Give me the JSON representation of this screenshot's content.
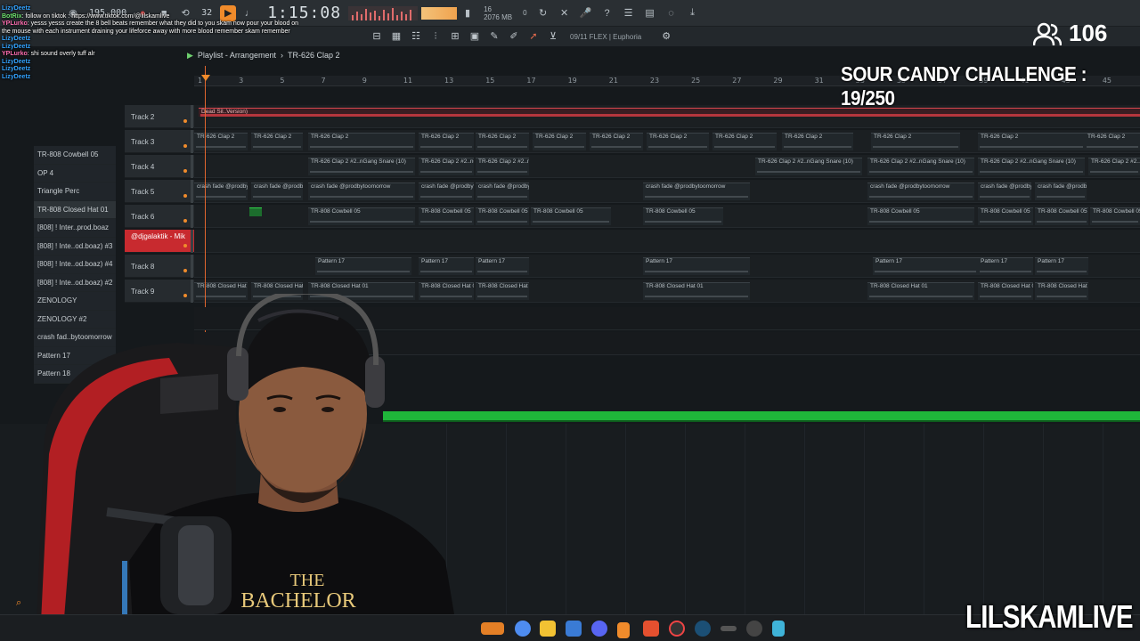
{
  "toolbar": {
    "tempo": "195.000",
    "pattern_num": "32",
    "time": "1:15:08",
    "stats_top": "16",
    "stats_mem": "2076 MB",
    "stats_cpu": "0"
  },
  "toolbar2": {
    "flex_label": "09/11  FLEX | Euphoria"
  },
  "playlist": {
    "title": "Playlist - Arrangement",
    "current_pattern": "TR-626 Clap 2",
    "ruler_bars": [
      "1",
      "3",
      "5",
      "7",
      "9",
      "11",
      "13",
      "15",
      "17",
      "19",
      "21",
      "23",
      "25",
      "27",
      "29",
      "31",
      "33",
      "35",
      "37",
      "39",
      "41",
      "43",
      "45"
    ]
  },
  "tracks": [
    {
      "name": "Track 2",
      "clip_label": "Dead Sil..Version)"
    },
    {
      "name": "Track 3",
      "clip_label": "TR-626 Clap 2"
    },
    {
      "name": "Track 4",
      "clip_label": "TR-626 Clap 2 #2..nGang Snare (10)"
    },
    {
      "name": "Track 5",
      "clip_label": "crash fade @prodbytoomorrow"
    },
    {
      "name": "Track 6",
      "clip_label": "TR-808 Cowbell 05"
    },
    {
      "name": "@djgalaktik - Mik",
      "clip_label": ""
    },
    {
      "name": "Track 8",
      "clip_label": "Pattern 17"
    },
    {
      "name": "Track 9",
      "clip_label": "TR-808 Closed Hat 01"
    }
  ],
  "channels": [
    "TR-808 Cowbell 05",
    "OP 4",
    "Triangle Perc",
    "TR-808 Closed Hat 01",
    "[808] ! Inter..prod.boaz",
    "[808] ! Inte..od.boaz) #3",
    "[808] ! Inte..od.boaz) #4",
    "[808] ! Inte..od.boaz) #2",
    "ZENOLOGY",
    "ZENOLOGY #2",
    "crash fad..bytoomorrow",
    "Pattern 17",
    "Pattern 18"
  ],
  "chat": [
    {
      "user": "LizyDeetz",
      "text": ""
    },
    {
      "user": "BotRix",
      "text": ": follow on tiktok : https://www.tiktok.com/@lilskamlive"
    },
    {
      "user": "YPLurko",
      "text": ": yesss yesss create the 8 bell beats remember what they did to you skam now pour your blood on"
    },
    {
      "user": "",
      "text": "the mouse with each instrument draining your lifeforce away with more blood remember skam remember"
    },
    {
      "user": "LizyDeetz",
      "text": ""
    },
    {
      "user": "LizyDeetz",
      "text": ""
    },
    {
      "user": "YPLurko",
      "text": ": shi sound overly tuff alr"
    },
    {
      "user": "LizyDeetz",
      "text": ""
    },
    {
      "user": "LizyDeetz",
      "text": ""
    },
    {
      "user": "LizyDeetz",
      "text": ""
    }
  ],
  "overlay": {
    "viewer_count": "106",
    "challenge": "SOUR CANDY CHALLENGE : 19/250",
    "channel_name": "LILSKAMLIVE"
  },
  "shirt": {
    "line1": "THE",
    "line2": "BACHELOR"
  },
  "colors": {
    "accent": "#f08b2b",
    "red_track": "#c82a2f",
    "green_bar": "#1fb63a"
  }
}
